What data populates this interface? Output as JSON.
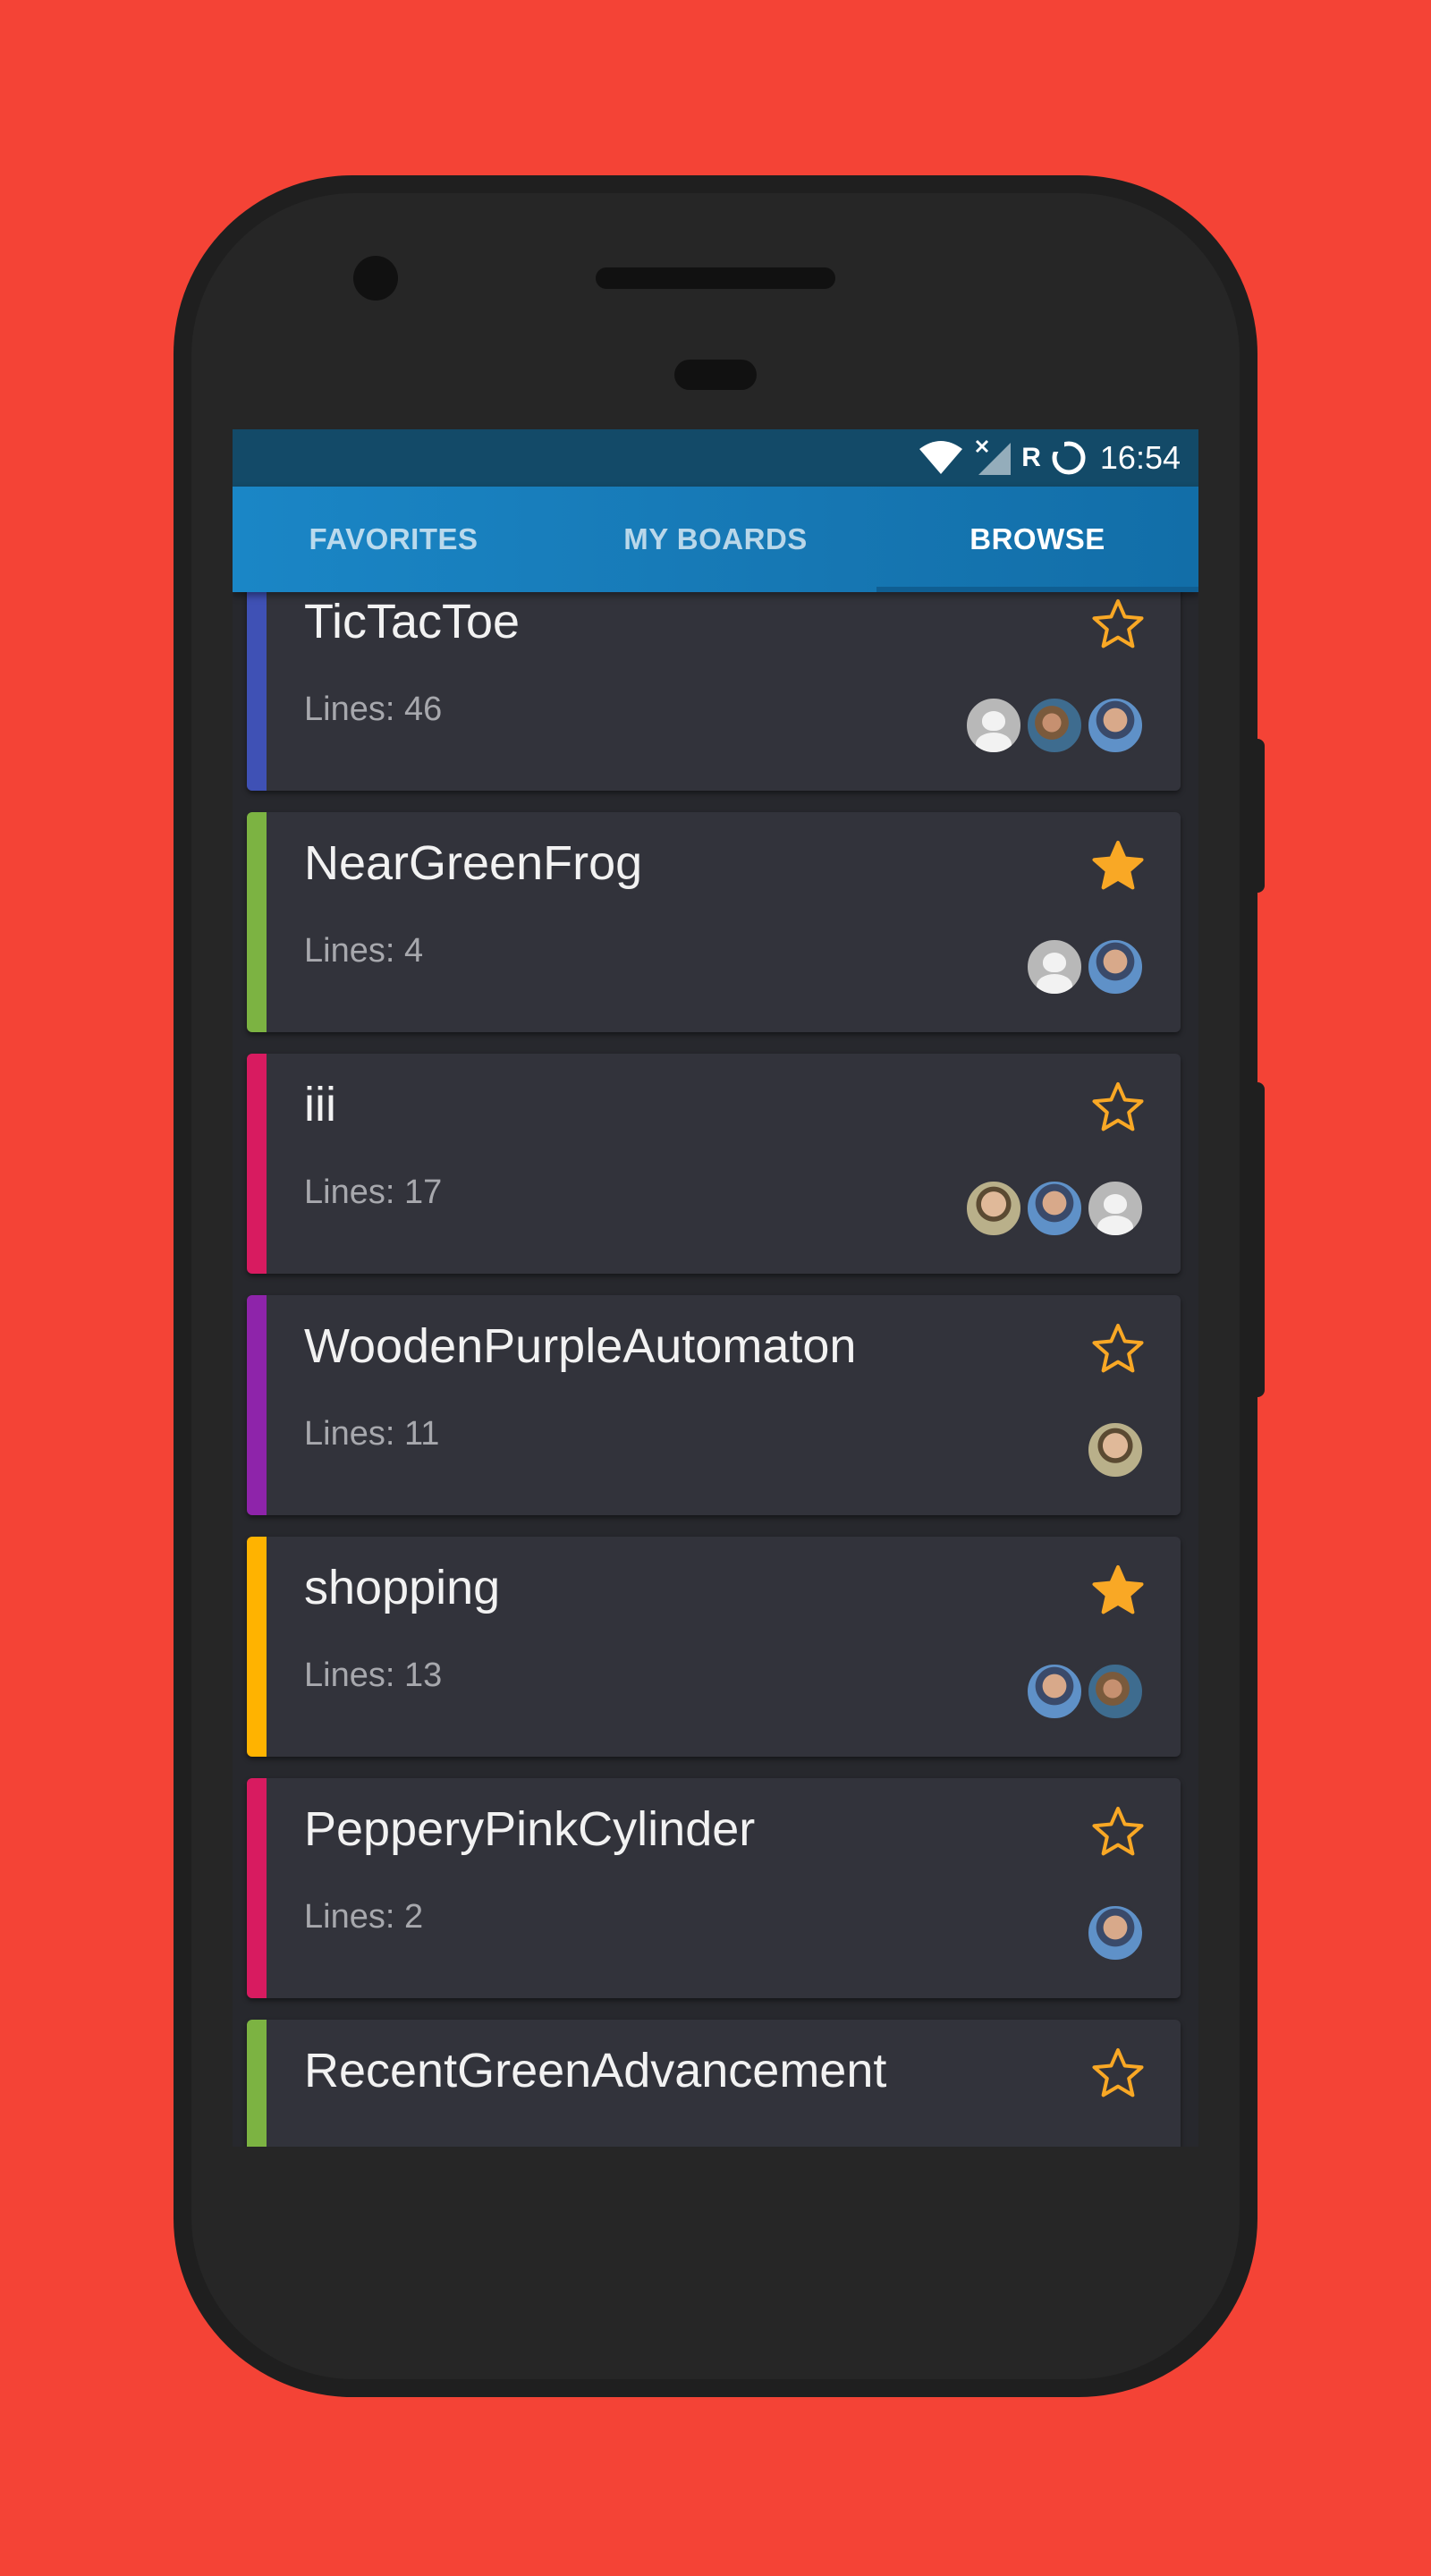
{
  "status_bar": {
    "roaming": "R",
    "time": "16:54"
  },
  "tabs": [
    {
      "label": "FAVORITES",
      "active": false
    },
    {
      "label": "MY BOARDS",
      "active": false
    },
    {
      "label": "BROWSE",
      "active": true
    }
  ],
  "boards": [
    {
      "title": "TicTacToe",
      "lines": "Lines: 46",
      "favorite": false,
      "color": "#3f51b5",
      "avatars": [
        "placeholder",
        "person-landscape",
        "person-sunglasses"
      ]
    },
    {
      "title": "NearGreenFrog",
      "lines": "Lines: 4",
      "favorite": true,
      "color": "#7cb342",
      "avatars": [
        "placeholder",
        "person-sunglasses"
      ]
    },
    {
      "title": "iii",
      "lines": "Lines: 17",
      "favorite": false,
      "color": "#d81b60",
      "avatars": [
        "person-beige",
        "person-sunglasses",
        "placeholder"
      ]
    },
    {
      "title": "WoodenPurpleAutomaton",
      "lines": "Lines: 11",
      "favorite": false,
      "color": "#8e24aa",
      "avatars": [
        "person-beige"
      ]
    },
    {
      "title": "shopping",
      "lines": "Lines: 13",
      "favorite": true,
      "color": "#ffb300",
      "avatars": [
        "person-sunglasses",
        "person-landscape"
      ]
    },
    {
      "title": "PepperyPinkCylinder",
      "lines": "Lines: 2",
      "favorite": false,
      "color": "#d81b60",
      "avatars": [
        "person-sunglasses"
      ]
    },
    {
      "title": "RecentGreenAdvancement",
      "lines": "",
      "favorite": false,
      "color": "#7cb342",
      "avatars": []
    }
  ],
  "colors": {
    "background": "#f44336",
    "accent_star": "#f9a825",
    "tab_bar": "#1a86c6",
    "status_bar": "#134a68"
  }
}
